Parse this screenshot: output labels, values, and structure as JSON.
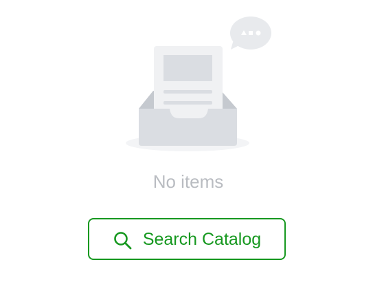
{
  "empty_state": {
    "illustration_icon": "empty-inbox-illustration",
    "message": "No items"
  },
  "search_button": {
    "label": "Search Catalog",
    "icon": "search-icon"
  },
  "colors": {
    "accent": "#16981f",
    "muted_text": "#b9bcc1",
    "illustration_light": "#f0f1f3",
    "illustration_mid": "#dadde2",
    "illustration_dark": "#c5c9cf"
  }
}
